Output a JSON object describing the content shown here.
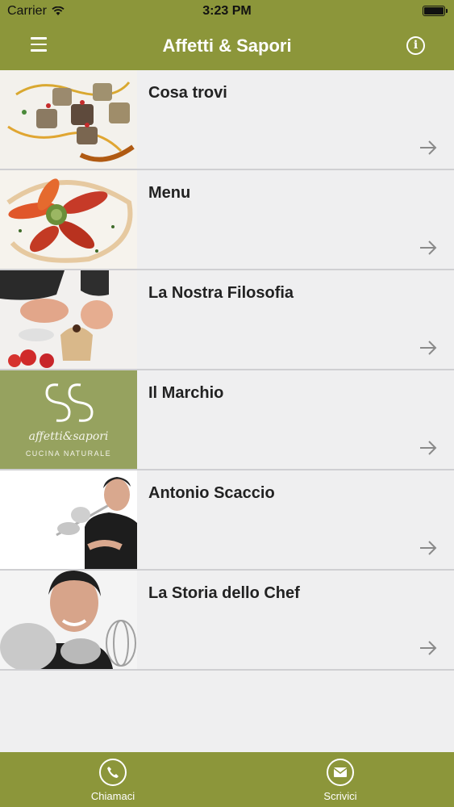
{
  "status_bar": {
    "carrier": "Carrier",
    "time": "3:23 PM"
  },
  "nav": {
    "title": "Affetti & Sapori",
    "menu_icon": "hamburger-icon",
    "info_icon": "info-icon",
    "info_glyph": "i"
  },
  "list": [
    {
      "label": "Cosa trovi"
    },
    {
      "label": "Menu"
    },
    {
      "label": "La Nostra Filosofia"
    },
    {
      "label": "Il Marchio"
    },
    {
      "label": "Antonio Scaccio"
    },
    {
      "label": "La Storia dello Chef"
    }
  ],
  "logo": {
    "wordmark": "affetti&sapori",
    "tagline": "CUCINA NATURALE"
  },
  "tabbar": {
    "call_label": "Chiamaci",
    "mail_label": "Scrivici"
  },
  "colors": {
    "brand": "#8c963a",
    "logo_bg": "#96a25f"
  }
}
